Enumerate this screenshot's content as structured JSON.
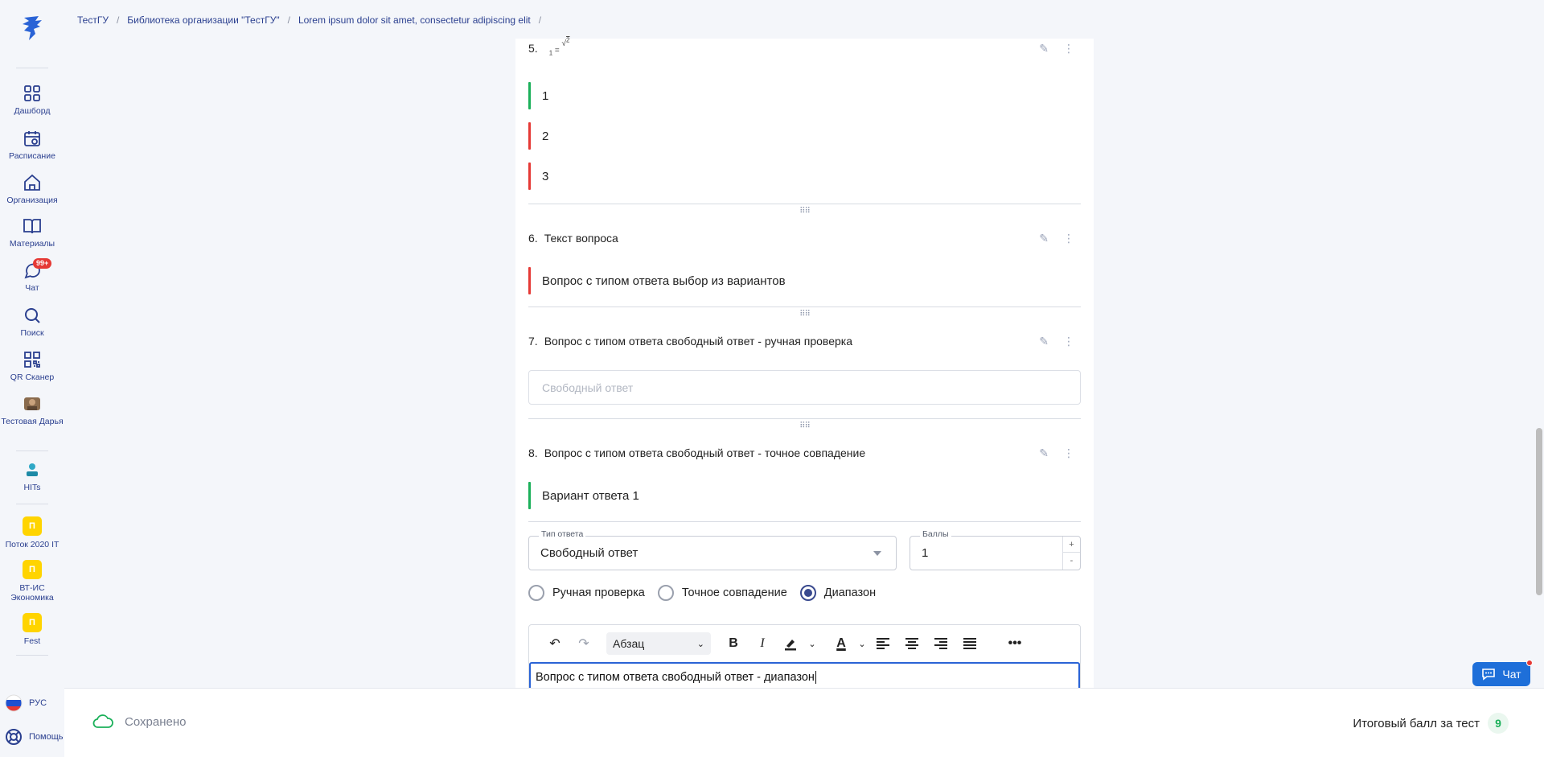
{
  "colors": {
    "accent": "#2a3f8f",
    "correct": "#1bb05a",
    "incorrect": "#e53935",
    "chat_button": "#1e6fd9",
    "badge": "#ffd400"
  },
  "breadcrumb": {
    "items": [
      "ТестГУ",
      "Библиотека организации \"ТестГУ\"",
      "Lorem ipsum dolor sit amet, consectetur adipiscing elit"
    ],
    "separator": "/"
  },
  "sidebar": {
    "items": [
      {
        "label": "Дашборд",
        "icon": "grid-icon"
      },
      {
        "label": "Расписание",
        "icon": "calendar-icon"
      },
      {
        "label": "Организация",
        "icon": "home-icon"
      },
      {
        "label": "Материалы",
        "icon": "book-icon"
      },
      {
        "label": "Чат",
        "icon": "chat-icon",
        "badge": "99+"
      },
      {
        "label": "Поиск",
        "icon": "search-icon"
      },
      {
        "label": "QR Сканер",
        "icon": "qr-icon"
      },
      {
        "label": "Тестовая Дарья",
        "icon": "avatar-icon"
      },
      {
        "label": "HITs",
        "icon": "hits-icon"
      }
    ],
    "groups": [
      {
        "letter": "П",
        "label": "Поток 2020 IT"
      },
      {
        "letter": "П",
        "label": "ВТ-ИС Экономика"
      },
      {
        "letter": "П",
        "label": "Fest"
      }
    ],
    "language": "РУС",
    "help": "Помощь"
  },
  "questions": {
    "q5": {
      "number": "5.",
      "formula": {
        "subscript": "1",
        "equals": "=",
        "root_sub": "2"
      },
      "options": [
        {
          "text": "1",
          "status": "correct"
        },
        {
          "text": "2",
          "status": "incorrect"
        },
        {
          "text": "3",
          "status": "incorrect"
        }
      ]
    },
    "q6": {
      "number": "6.",
      "title": "Текст вопроса",
      "options": [
        {
          "text": "Вопрос с типом ответа выбор из вариантов",
          "status": "incorrect"
        }
      ]
    },
    "q7": {
      "number": "7.",
      "title": "Вопрос с типом ответа свободный ответ - ручная проверка",
      "placeholder": "Свободный ответ"
    },
    "q8": {
      "number": "8.",
      "title": "Вопрос с типом ответа свободный ответ - точное совпадение",
      "options": [
        {
          "text": "Вариант ответа 1",
          "status": "correct"
        }
      ]
    }
  },
  "edit_form": {
    "answer_type_label": "Тип ответа",
    "answer_type_value": "Свободный ответ",
    "points_label": "Баллы",
    "points_value": "1",
    "stepper_plus": "+",
    "stepper_minus": "-",
    "check_modes": [
      {
        "label": "Ручная проверка",
        "selected": false
      },
      {
        "label": "Точное совпадение",
        "selected": false
      },
      {
        "label": "Диапазон",
        "selected": true
      }
    ],
    "editor": {
      "block_format": "Абзац",
      "text": "Вопрос с типом ответа свободный ответ - диапазон"
    }
  },
  "chat_fab": {
    "label": "Чат"
  },
  "footer": {
    "saved": "Сохранено",
    "total_label": "Итоговый балл за тест",
    "total_value": "9"
  }
}
